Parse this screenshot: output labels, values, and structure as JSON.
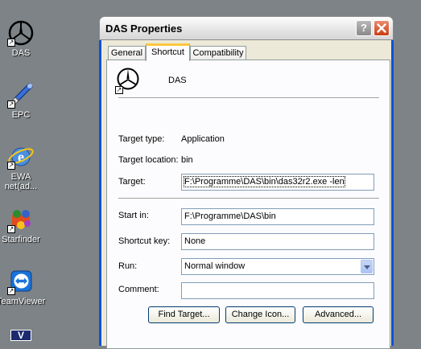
{
  "desktop": {
    "icons": [
      {
        "label": "DAS",
        "icon": "mercedes-star-icon"
      },
      {
        "label": "EPC",
        "icon": "epc-tool-icon"
      },
      {
        "label": "EWA net(ad...",
        "icon": "internet-explorer-icon"
      },
      {
        "label": "Starfinder",
        "icon": "starfinder-icon"
      },
      {
        "label": "TeamViewer",
        "icon": "teamviewer-icon"
      }
    ]
  },
  "window": {
    "title": "DAS Properties",
    "help_label": "?",
    "close_label": "✕"
  },
  "tabs": [
    {
      "label": "General",
      "active": false
    },
    {
      "label": "Shortcut",
      "active": true
    },
    {
      "label": "Compatibility",
      "active": false
    }
  ],
  "shortcut": {
    "name": "DAS",
    "target_type_label": "Target type:",
    "target_type": "Application",
    "target_location_label": "Target location:",
    "target_location": "bin",
    "target_label": "Target:",
    "target": "F:\\Programme\\DAS\\bin\\das32r2.exe -len",
    "start_in_label": "Start in:",
    "start_in": "F:\\Programme\\DAS\\bin",
    "shortcut_key_label": "Shortcut key:",
    "shortcut_key": "None",
    "run_label": "Run:",
    "run": "Normal window",
    "comment_label": "Comment:",
    "comment": ""
  },
  "buttons": {
    "find_target": "Find Target...",
    "change_icon": "Change Icon...",
    "advanced": "Advanced..."
  },
  "colors": {
    "desktop": "#7d8387",
    "active_tab_accent": "#ffc83c",
    "window_frame": "#0a53d9",
    "close_button": "#c93d14"
  }
}
